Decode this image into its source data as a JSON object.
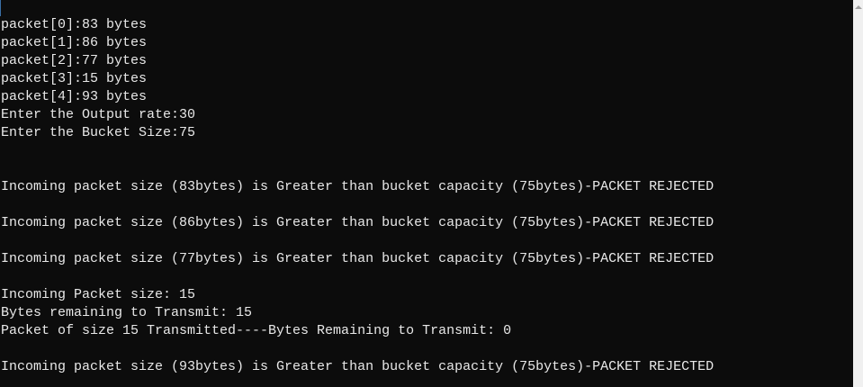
{
  "terminal": {
    "lines": [
      "packet[0]:83 bytes",
      "packet[1]:86 bytes",
      "packet[2]:77 bytes",
      "packet[3]:15 bytes",
      "packet[4]:93 bytes",
      "Enter the Output rate:30",
      "Enter the Bucket Size:75",
      "",
      "",
      "Incoming packet size (83bytes) is Greater than bucket capacity (75bytes)-PACKET REJECTED",
      "",
      "Incoming packet size (86bytes) is Greater than bucket capacity (75bytes)-PACKET REJECTED",
      "",
      "Incoming packet size (77bytes) is Greater than bucket capacity (75bytes)-PACKET REJECTED",
      "",
      "Incoming Packet size: 15",
      "Bytes remaining to Transmit: 15",
      "Packet of size 15 Transmitted----Bytes Remaining to Transmit: 0",
      "",
      "Incoming packet size (93bytes) is Greater than bucket capacity (75bytes)-PACKET REJECTED"
    ]
  }
}
